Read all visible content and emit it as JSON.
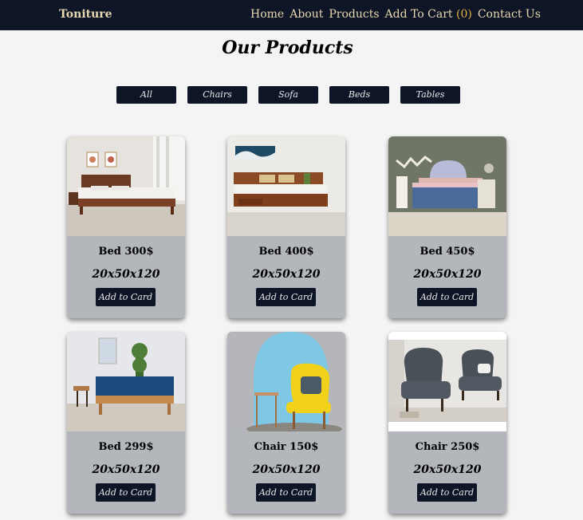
{
  "navbar": {
    "brand": "Toniture",
    "links": {
      "home": "Home",
      "about": "About",
      "products": "Products",
      "cart": "Add To Cart",
      "cart_count_open": "(",
      "cart_count": "0",
      "cart_count_close": ")",
      "contact": "Contact Us"
    }
  },
  "page": {
    "title": "Our Products"
  },
  "filters": [
    "All",
    "Chairs",
    "Sofa",
    "Beds",
    "Tables"
  ],
  "products": [
    {
      "name": "Bed 300$",
      "dims": "20x50x120",
      "button": "Add to Card",
      "image": "bed-photo"
    },
    {
      "name": "Bed 400$",
      "dims": "20x50x120",
      "button": "Add to Card",
      "image": "bed-photo"
    },
    {
      "name": "Bed 450$",
      "dims": "20x50x120",
      "button": "Add to Card",
      "image": "bed-photo"
    },
    {
      "name": "Bed 299$",
      "dims": "20x50x120",
      "button": "Add to Card",
      "image": "bed-photo"
    },
    {
      "name": "Chair 150$",
      "dims": "20x50x120",
      "button": "Add to Card",
      "image": "chair-photo"
    },
    {
      "name": "Chair 250$",
      "dims": "20x50x120",
      "button": "Add to Card",
      "image": "chair-photo"
    }
  ],
  "colors": {
    "navbar": "#0e1526",
    "nav_text": "#e8d8b0",
    "cart_count": "#e2b53a",
    "card": "#b3b6bb",
    "page_bg": "#f4f4f4"
  }
}
